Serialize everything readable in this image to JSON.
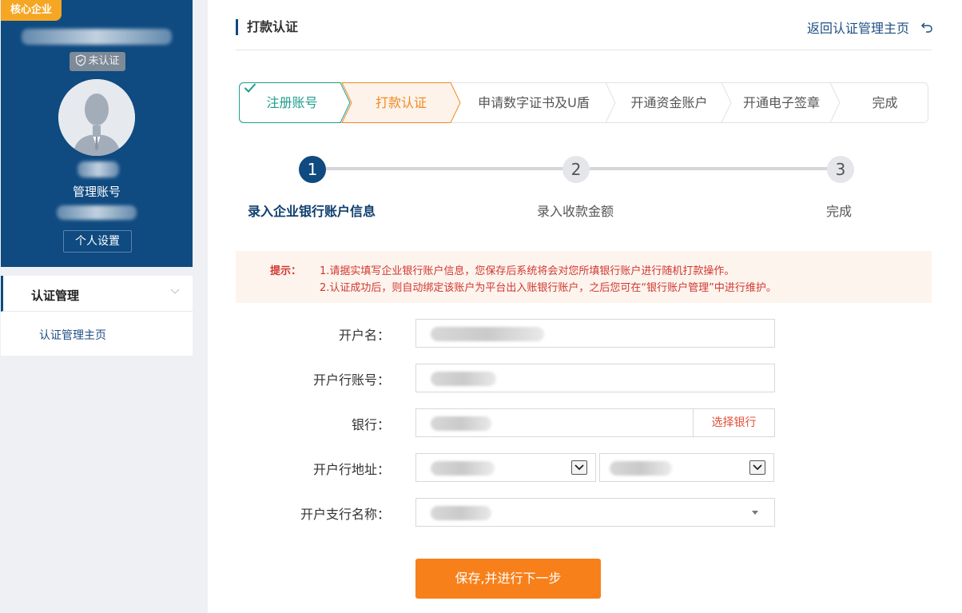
{
  "sidebar": {
    "badge": "核心企业",
    "cert_status": "未认证",
    "role": "管理账号",
    "settings_label": "个人设置",
    "menu_header": "认证管理",
    "menu_item": "认证管理主页"
  },
  "header": {
    "title": "打款认证",
    "back_label": "返回认证管理主页"
  },
  "steps": [
    {
      "label": "注册账号",
      "state": "done"
    },
    {
      "label": "打款认证",
      "state": "active"
    },
    {
      "label": "申请数字证书及U盾",
      "state": "pending"
    },
    {
      "label": "开通资金账户",
      "state": "pending"
    },
    {
      "label": "开通电子签章",
      "state": "pending"
    },
    {
      "label": "完成",
      "state": "pending"
    }
  ],
  "progress": [
    {
      "num": "1",
      "label": "录入企业银行账户信息",
      "state": "active"
    },
    {
      "num": "2",
      "label": "录入收款金额",
      "state": "pending"
    },
    {
      "num": "3",
      "label": "完成",
      "state": "pending"
    }
  ],
  "notice": {
    "tip_label": "提示：",
    "line1": "1.请据实填写企业银行账户信息，您保存后系统将会对您所填银行账户进行随机打款操作。",
    "line2": "2.认证成功后，则自动绑定该账户为平台出入账银行账户，之后您可在“银行账户管理”中进行维护。"
  },
  "form": {
    "account_name_label": "开户名：",
    "account_no_label": "开户行账号：",
    "bank_label": "银行：",
    "select_bank_label": "选择银行",
    "address_label": "开户行地址：",
    "branch_label": "开户支行名称："
  },
  "submit_label": "保存,并进行下一步",
  "colors": {
    "primary": "#0f4a80",
    "accent": "#f7801b",
    "done": "#1e9c8e",
    "warning": "#d0382f"
  }
}
